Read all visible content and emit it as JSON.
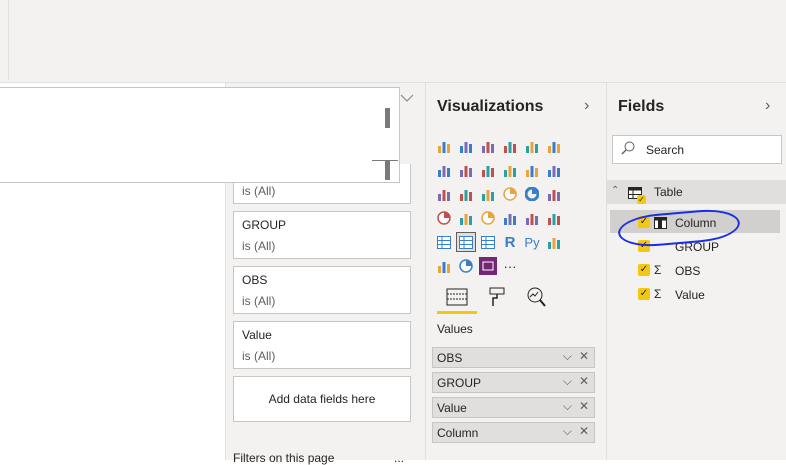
{
  "filters": {
    "cards": [
      {
        "name": "",
        "value": "is (All)"
      },
      {
        "name": "GROUP",
        "value": "is (All)"
      },
      {
        "name": "OBS",
        "value": "is (All)"
      },
      {
        "name": "Value",
        "value": "is (All)"
      }
    ],
    "add_label": "Add data fields here",
    "on_this_page": "Filters on this page",
    "more": "..."
  },
  "visualizations": {
    "title": "Visualizations",
    "arrow": "›",
    "values_label": "Values",
    "more_glyph": "···",
    "r_glyph": "R",
    "py_glyph": "Py",
    "wells": [
      {
        "label": "OBS"
      },
      {
        "label": "GROUP"
      },
      {
        "label": "Value"
      },
      {
        "label": "Column"
      }
    ],
    "accent": "#f2c811"
  },
  "fields": {
    "title": "Fields",
    "arrow": "›",
    "search_placeholder": "Search",
    "table_name": "Table",
    "items": [
      {
        "label": "Column",
        "icon": "table-column-icon"
      },
      {
        "label": "GROUP",
        "icon": ""
      },
      {
        "label": "OBS",
        "icon": "sigma-icon"
      },
      {
        "label": "Value",
        "icon": "sigma-icon"
      }
    ],
    "sigma": "Σ",
    "check": "✓"
  },
  "colors": {
    "annotation": "#1a2ee8",
    "checkbox": "#f2c811"
  }
}
